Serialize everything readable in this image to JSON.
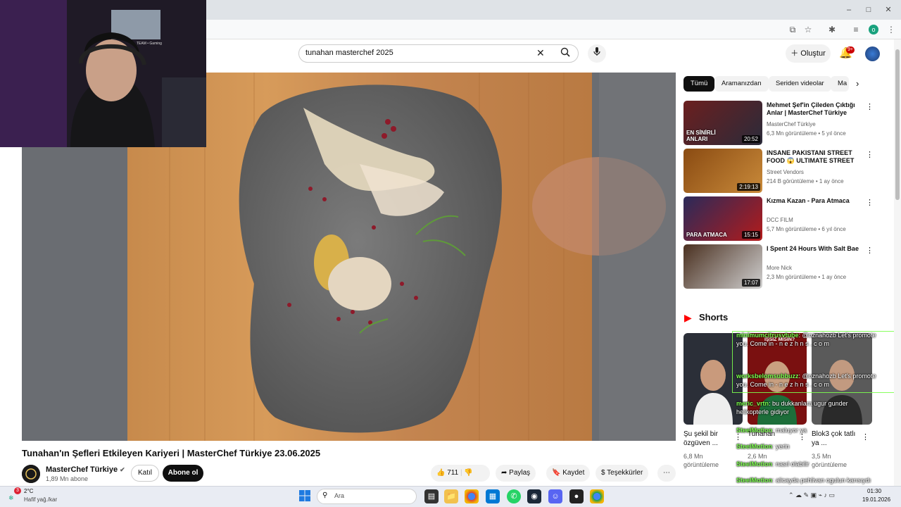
{
  "browser": {
    "window_controls": {
      "minimize": "‒",
      "maximize": "□",
      "close": "✕"
    },
    "profile_initial": "o"
  },
  "header": {
    "search_value": "tunahan masterchef 2025",
    "create_label": "Oluştur",
    "notif_count": "9+"
  },
  "video": {
    "title": "Tunahan'ın Şefleri Etkileyen Kariyeri | MasterChef Türkiye 23.06.2025",
    "channel": "MasterChef Türkiye",
    "subscribers": "1,89 Mn abone",
    "join_label": "Katıl",
    "subscribe_label": "Abone ol",
    "likes": "711",
    "share_label": "Paylaş",
    "save_label": "Kaydet",
    "thanks_label": "Teşekkürler",
    "more": "⋯"
  },
  "chips": [
    "Tümü",
    "Aramanızdan",
    "Seriden videolar",
    "Ma"
  ],
  "related": [
    {
      "title": "Mehmet Şef'in Çileden Çıktığı Anlar | MasterChef Türkiye",
      "channel": "MasterChef Türkiye",
      "meta": "6,3 Mn görüntüleme • 5 yıl önce",
      "duration": "20:52",
      "thumb_text": "EN SİNİRLİ ANLARI",
      "colors": [
        "#6b1f1f",
        "#2b2b3a"
      ]
    },
    {
      "title": "INSANE PAKISTANI STREET FOOD 😱 ULTIMATE STREET ...",
      "channel": "Street Vendors",
      "meta": "214 B görüntüleme • 1 ay önce",
      "duration": "2:19:13",
      "thumb_text": "",
      "colors": [
        "#8a4b12",
        "#c98a3a"
      ]
    },
    {
      "title": "Kızma Kazan - Para Atmaca",
      "channel": "DCC FILM",
      "meta": "5,7 Mn görüntüleme • 6 yıl önce",
      "duration": "15:15",
      "thumb_text": "PARA ATMACA",
      "colors": [
        "#2a2a5a",
        "#b31b1b"
      ]
    },
    {
      "title": "I Spent 24 Hours With Salt Bae",
      "channel": "More Nick",
      "meta": "2,3 Mn görüntüleme • 1 ay önce",
      "duration": "17:07",
      "thumb_text": "",
      "colors": [
        "#4a3020",
        "#d0d0d0"
      ]
    }
  ],
  "shorts": {
    "heading": "Shorts",
    "items": [
      {
        "title": "Şu şekil bir özgüven ...",
        "views": "6,8 Mn görüntüleme"
      },
      {
        "title": "Tunahan",
        "views": "2,6 Mn"
      },
      {
        "title": "Blok3 çok tatlı ya ...",
        "views": "3,5 Mn görüntüleme"
      }
    ]
  },
  "chat": [
    {
      "name": "minimumcitrusvtube",
      "msg": "@oznahozb Let's promote you. Come in - n e z h n s . c o m"
    },
    {
      "name": "worksbelomsubbuzz",
      "msg": "@oznahozb Let's promote you. Come in - n e z h n s . c o m"
    },
    {
      "name": "meric_vrtn",
      "msg": "bu dukkanlara ugur gunder helikopterle gidiyor"
    },
    {
      "name": "SteelMotion",
      "msg": "maluyor ya"
    },
    {
      "name": "SteelMotion",
      "msg": "yerin"
    },
    {
      "name": "SteelMotion",
      "msg": "nasıl olabilir"
    },
    {
      "name": "SteelMotion",
      "msg": "alicayda pehlivan ogulun karısıydı"
    }
  ],
  "webcam": {
    "overlay_text": "TEAM • Gaming"
  },
  "thumbnail_overlay": {
    "shorts_top_text": "İŞSİZ MİSİN?"
  },
  "taskbar": {
    "weather_temp": "2°C",
    "weather_desc": "Hafif yağ./kar",
    "weather_badge": "3",
    "search_placeholder": "Ara",
    "time": "01:30",
    "date": "19.01.2026"
  }
}
